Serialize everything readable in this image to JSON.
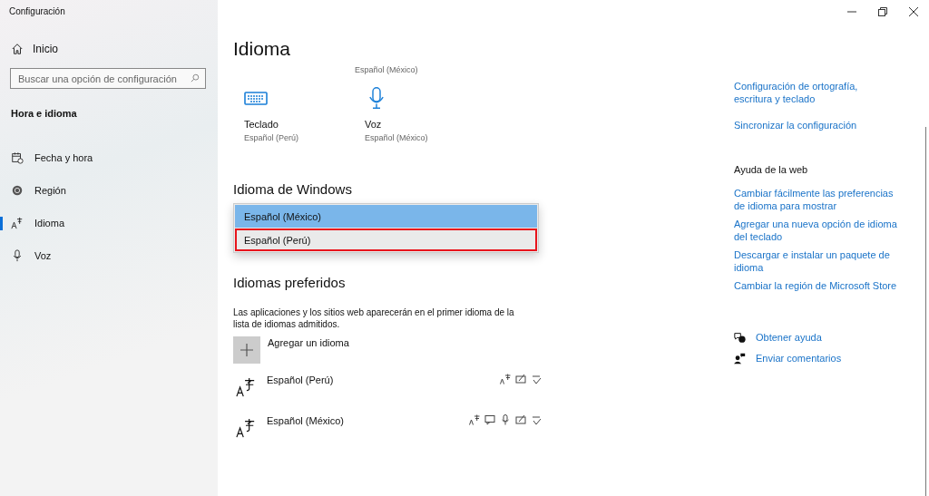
{
  "window": {
    "title": "Configuración"
  },
  "sidebar": {
    "home": "Inicio",
    "search": {
      "placeholder": "Buscar una opción de configuración"
    },
    "section": "Hora e idioma",
    "items": [
      {
        "label": "Fecha y hora",
        "selected": false
      },
      {
        "label": "Región",
        "selected": false
      },
      {
        "label": "Idioma",
        "selected": true
      },
      {
        "label": "Voz",
        "selected": false
      }
    ]
  },
  "page": {
    "title": "Idioma",
    "top_value": "Español (México)",
    "tiles": [
      {
        "label": "Teclado",
        "value": "Español (Perú)"
      },
      {
        "label": "Voz",
        "value": "Español (México)"
      }
    ],
    "windows_language": {
      "heading": "Idioma de Windows",
      "dropdown": [
        {
          "label": "Español (México)",
          "selected": true,
          "outlined": false
        },
        {
          "label": "Español (Perú)",
          "selected": false,
          "outlined": true
        }
      ]
    },
    "preferred": {
      "heading": "Idiomas preferidos",
      "description": "Las aplicaciones y los sitios web aparecerán en el primer idioma de la lista de idiomas admitidos.",
      "add": "Agregar un idioma",
      "languages": [
        {
          "name": "Español (Perú)",
          "features": [
            {
              "kind": "display"
            },
            {
              "kind": "handwriting"
            },
            {
              "kind": "spelling"
            }
          ]
        },
        {
          "name": "Español (México)",
          "features": [
            {
              "kind": "display"
            },
            {
              "kind": "speech"
            },
            {
              "kind": "mic"
            },
            {
              "kind": "handwriting"
            },
            {
              "kind": "spelling"
            }
          ]
        }
      ]
    }
  },
  "related": {
    "links": [
      "Configuración de ortografía, escritura y teclado",
      "Sincronizar la configuración"
    ],
    "help_heading": "Ayuda de la web",
    "help_links": [
      "Cambiar fácilmente las preferencias de idioma para mostrar",
      "Agregar una nueva opción de idioma del teclado",
      "Descargar e instalar un paquete de idioma",
      "Cambiar la región de Microsoft Store"
    ],
    "actions": [
      "Obtener ayuda",
      "Enviar comentarios"
    ]
  }
}
